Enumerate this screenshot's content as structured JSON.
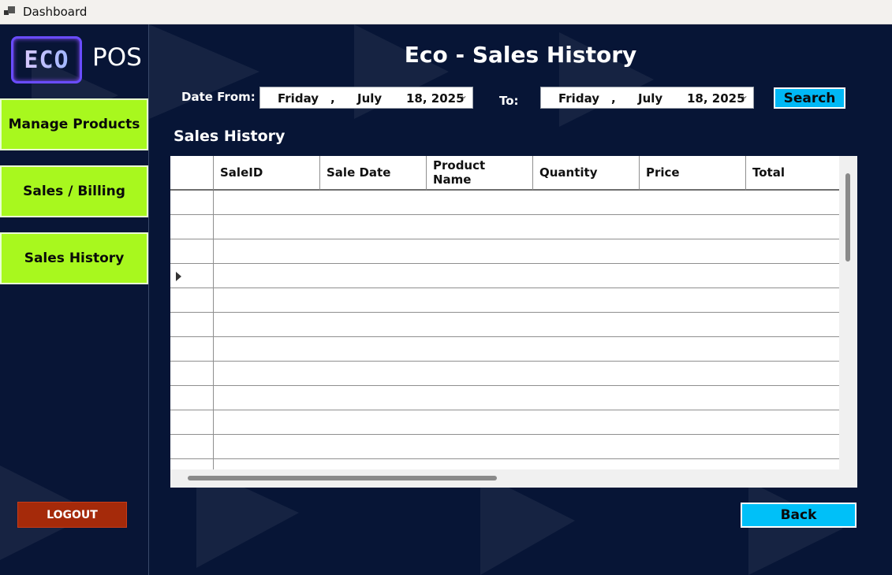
{
  "window": {
    "title": "Dashboard"
  },
  "logo": {
    "eco": "ECO",
    "pos": "POS"
  },
  "sidebar": {
    "items": [
      {
        "label": "Manage Products"
      },
      {
        "label": "Sales / Billing"
      },
      {
        "label": "Sales History"
      }
    ],
    "logout_label": "LOGOUT"
  },
  "page": {
    "title": "Eco - Sales History"
  },
  "filters": {
    "from_label": "Date From:",
    "to_label": "To:",
    "from": {
      "weekday": "Friday",
      "sep": ",",
      "month": "July",
      "day_year": "18, 2025"
    },
    "to": {
      "weekday": "Friday",
      "sep": ",",
      "month": "July",
      "day_year": "18, 2025"
    },
    "search_label": "Search"
  },
  "history": {
    "section_title": "Sales History",
    "columns": [
      "SaleID",
      "Sale Date",
      "Product\nName",
      "Quantity",
      "Price",
      "Total"
    ],
    "rows": [
      [],
      [],
      [],
      [],
      [],
      [],
      [],
      [],
      [],
      [],
      [],
      []
    ],
    "current_row_index": 3
  },
  "footer": {
    "back_label": "Back"
  },
  "colors": {
    "sidebar_button": "#a8f81e",
    "accent_button": "#00b8f5",
    "logout": "#a52a0a",
    "background": "#071536"
  }
}
